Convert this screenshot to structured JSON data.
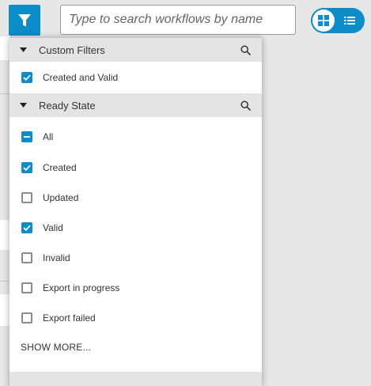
{
  "colors": {
    "accent": "#0c8cc8",
    "header_bg": "#e4e4e4",
    "page_bg": "#e7e7e7"
  },
  "toolbar": {
    "filter_icon": "funnel-icon",
    "search_placeholder": "Type to search workflows by name",
    "search_value": "",
    "view_toggle": {
      "grid_icon": "grid-icon",
      "list_icon": "list-icon",
      "selected": "grid"
    }
  },
  "filters": {
    "sections": [
      {
        "title": "Custom Filters",
        "expanded": true,
        "options": [
          {
            "label": "Created and Valid",
            "state": "checked"
          }
        ]
      },
      {
        "title": "Ready State",
        "expanded": true,
        "options": [
          {
            "label": "All",
            "state": "indeterminate"
          },
          {
            "label": "Created",
            "state": "checked"
          },
          {
            "label": "Updated",
            "state": "unchecked"
          },
          {
            "label": "Valid",
            "state": "checked"
          },
          {
            "label": "Invalid",
            "state": "unchecked"
          },
          {
            "label": "Export in progress",
            "state": "unchecked"
          },
          {
            "label": "Export failed",
            "state": "unchecked"
          }
        ]
      }
    ],
    "show_more_label": "SHOW MORE..."
  }
}
